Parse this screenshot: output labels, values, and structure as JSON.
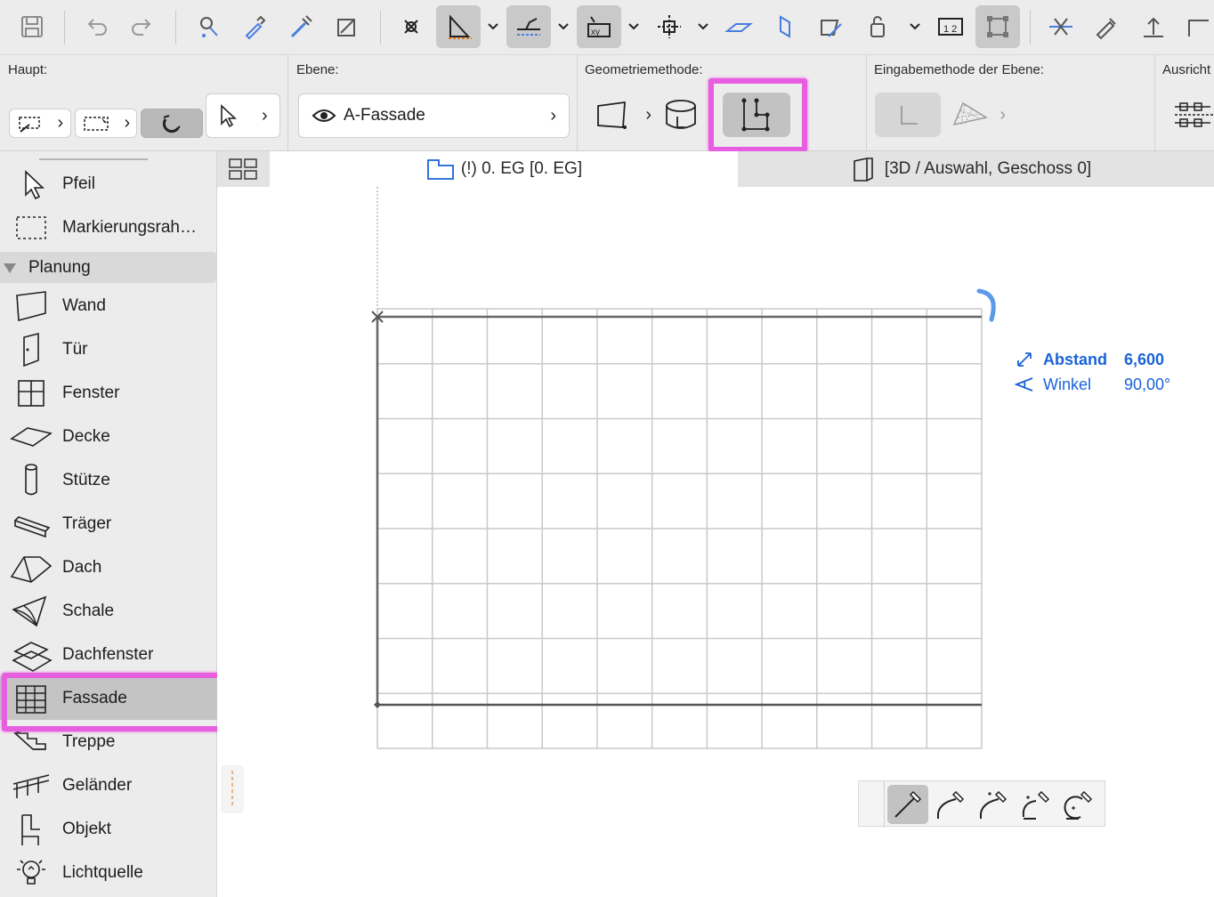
{
  "toolbar": {
    "icons": [
      "save-icon",
      "undo-icon",
      "redo-icon",
      "find-select-icon",
      "eyedropper-icon",
      "syringe-icon",
      "magic-wand-icon",
      "snap-point-icon",
      "guide-lines-icon",
      "snap-guides-icon",
      "relative-construction-icon",
      "grid-snap-icon",
      "parallel-plane-icon",
      "perpendicular-icon",
      "edit-plane-icon",
      "suspend-groups-icon",
      "dimension-icon",
      "group-icon",
      "split-icon",
      "adjust-icon",
      "elevate-icon",
      "offset-icon"
    ]
  },
  "infobox": {
    "haupt_label": "Haupt:",
    "ebene_label": "Ebene:",
    "ebene_value": "A-Fassade",
    "geometrie_label": "Geometriemethode:",
    "eingabe_label": "Eingabemethode der Ebene:",
    "ausricht_label": "Ausricht"
  },
  "toolbox": {
    "pfeil": "Pfeil",
    "marquee": "Markierungsrah…",
    "group": "Planung",
    "tools": [
      "Wand",
      "Tür",
      "Fenster",
      "Decke",
      "Stütze",
      "Träger",
      "Dach",
      "Schale",
      "Dachfenster",
      "Fassade",
      "Treppe",
      "Geländer",
      "Objekt",
      "Lichtquelle"
    ],
    "selected": "Fassade"
  },
  "tabs": {
    "floorplan": "(!) 0. EG [0. EG]",
    "threed": "[3D / Auswahl, Geschoss 0]"
  },
  "tracker": {
    "distance_label": "Abstand",
    "distance_value": "6,600",
    "angle_label": "Winkel",
    "angle_value": "90,00°"
  },
  "colors": {
    "accent": "#1a63d6",
    "highlight": "#e85ee0",
    "selection": "#c4c4c4"
  }
}
